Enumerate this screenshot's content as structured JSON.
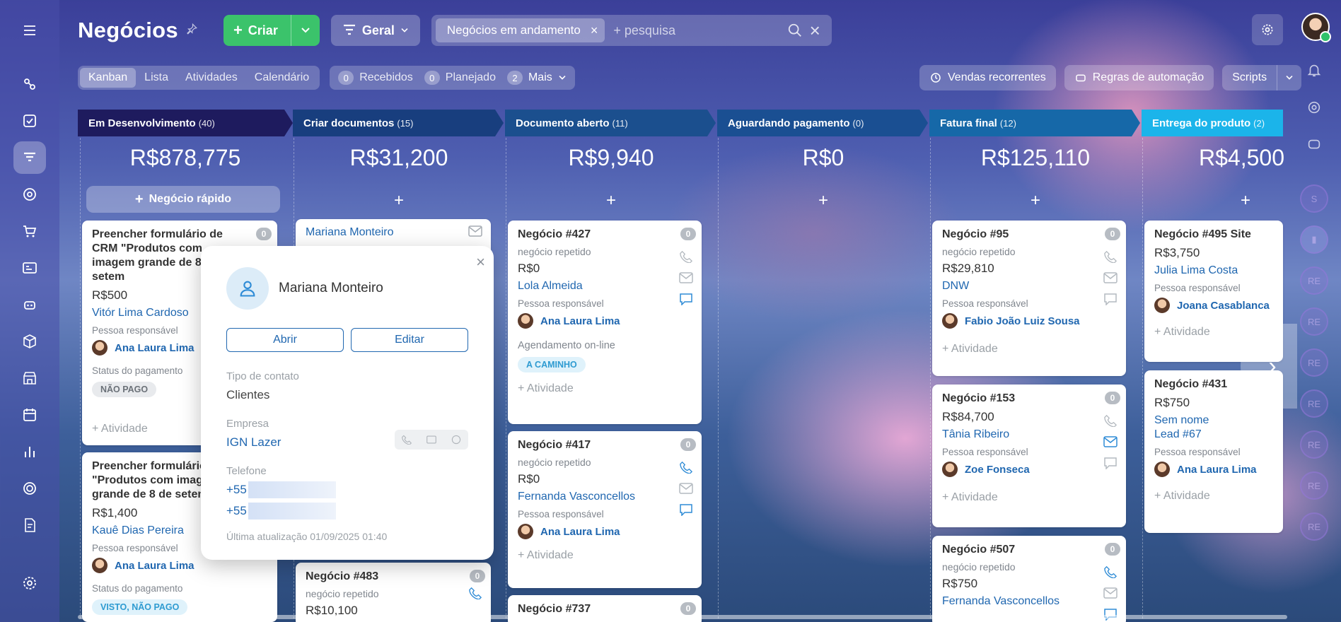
{
  "header": {
    "title": "Negócios",
    "create_label": "Criar",
    "general_label": "Geral",
    "filter_chip": "Negócios em andamento",
    "search_placeholder": "+ pesquisa"
  },
  "views": [
    "Kanban",
    "Lista",
    "Atividades",
    "Calendário"
  ],
  "counters": [
    {
      "count": "0",
      "label": "Recebidos"
    },
    {
      "count": "0",
      "label": "Planejado"
    },
    {
      "count": "2",
      "label": "Mais"
    }
  ],
  "toolbar_right": {
    "recurring": "Vendas recorrentes",
    "automation": "Regras de automação",
    "scripts": "Scripts"
  },
  "quick_deal": "Negócio rápido",
  "add_symbol": "+",
  "columns": [
    {
      "name": "Em Desenvolvimento",
      "count": "(40)",
      "total": "R$878,775",
      "color": "#1e1b5e"
    },
    {
      "name": "Criar documentos",
      "count": "(15)",
      "total": "R$31,200",
      "color": "#183e7e"
    },
    {
      "name": "Documento aberto",
      "count": "(11)",
      "total": "R$9,940",
      "color": "#1b4f8e"
    },
    {
      "name": "Aguardando pagamento",
      "count": "(0)",
      "total": "R$0",
      "color": "#1a4f92"
    },
    {
      "name": "Fatura final",
      "count": "(12)",
      "total": "R$125,110",
      "color": "#1668a8"
    },
    {
      "name": "Entrega do produto",
      "count": "(2)",
      "total": "R$4,500",
      "color": "#1bb4ea"
    }
  ],
  "labels": {
    "responsible": "Pessoa responsável",
    "activity": "+ Atividade",
    "payment_status": "Status do pagamento",
    "repeat": "negócio repetido",
    "online": "Agendamento on-line"
  },
  "cards": {
    "c1a": {
      "title": "Preencher formulário de CRM \"Produtos com imagem grande de 8 de setem",
      "badge": "0",
      "amount": "R$500",
      "contact": "Vitór Lima Cardoso",
      "person": "Ana Laura Lima",
      "status": "NÃO PAGO"
    },
    "c1b": {
      "title": "Preencher formulário \"Produtos com image grande de 8 de setem",
      "amount": "R$1,400",
      "contact": "Kauê Dias Pereira",
      "person": "Ana Laura Lima",
      "status": "VISTO, NÃO PAGO"
    },
    "c2a": {
      "contact": "Mariana Monteiro"
    },
    "c2b": {
      "title": "Negócio #483",
      "badge": "0",
      "amount": "R$10,100"
    },
    "c3a": {
      "title": "Negócio #427",
      "badge": "0",
      "amount": "R$0",
      "contact": "Lola Almeida",
      "person": "Ana Laura Lima",
      "status": "A CAMINHO"
    },
    "c3b": {
      "title": "Negócio #417",
      "badge": "0",
      "amount": "R$0",
      "contact": "Fernanda Vasconcellos",
      "person": "Ana Laura Lima"
    },
    "c3c": {
      "title": "Negócio #737",
      "badge": "0"
    },
    "c5a": {
      "title": "Negócio #95",
      "badge": "0",
      "amount": "R$29,810",
      "contact": "DNW",
      "person": "Fabio João Luiz Sousa"
    },
    "c5b": {
      "title": "Negócio #153",
      "badge": "0",
      "amount": "R$84,700",
      "contact": "Tânia Ribeiro",
      "person": "Zoe Fonseca"
    },
    "c5c": {
      "title": "Negócio #507",
      "badge": "0",
      "amount": "R$750",
      "contact": "Fernanda Vasconcellos"
    },
    "c6a": {
      "title": "Negócio #495 Site",
      "amount": "R$3,750",
      "contact": "Julia Lima Costa",
      "person": "Joana Casablanca"
    },
    "c6b": {
      "title": "Negócio #431",
      "amount": "R$750",
      "contact": "Sem nome",
      "contact2": "Lead #67",
      "person": "Ana Laura Lima"
    }
  },
  "popup": {
    "name": "Mariana Monteiro",
    "open_label": "Abrir",
    "edit_label": "Editar",
    "contact_type_label": "Tipo de contato",
    "contact_type_value": "Clientes",
    "company_label": "Empresa",
    "company_value": "IGN Lazer",
    "phone_label": "Telefone",
    "phones": [
      "+55",
      "+55"
    ],
    "updated": "Última atualização 01/09/2025 01:40"
  },
  "right_rail_initials": [
    "RE",
    "RE",
    "RE",
    "RE",
    "RE",
    "RE",
    "RE"
  ]
}
